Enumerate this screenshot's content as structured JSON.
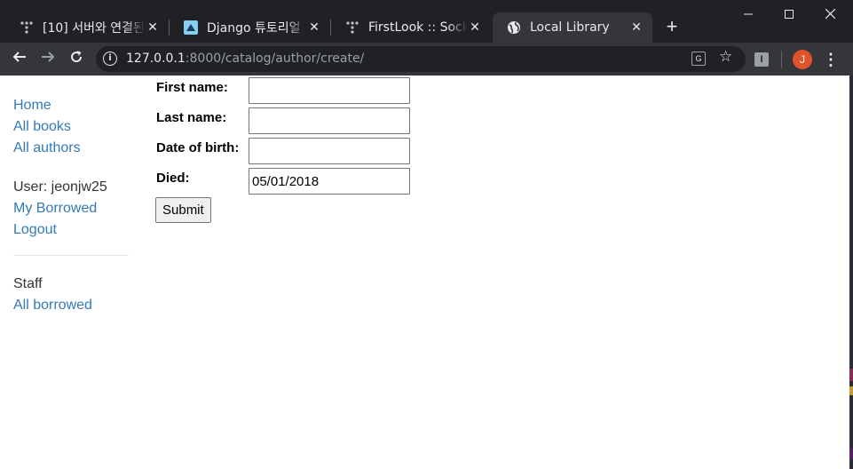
{
  "browser": {
    "tabs": [
      {
        "title": "[10] 서버와 연결된",
        "favicon": "tistory-icon"
      },
      {
        "title": "Django 튜토리얼",
        "favicon": "mdn-icon"
      },
      {
        "title": "FirstLook :: Socket",
        "favicon": "tistory-icon"
      },
      {
        "title": "Local Library",
        "favicon": "globe-icon"
      }
    ],
    "url": {
      "host": "127.0.0.1",
      "rest": ":8000/catalog/author/create/"
    },
    "profile_initial": "J",
    "extension_label": "I"
  },
  "sidebar": {
    "links": [
      "Home",
      "All books",
      "All authors"
    ],
    "user_label": "User: jeonjw25",
    "user_links": [
      "My Borrowed",
      "Logout"
    ],
    "staff_label": "Staff",
    "staff_links": [
      "All borrowed"
    ]
  },
  "form": {
    "fields": [
      {
        "label": "First name:",
        "value": ""
      },
      {
        "label": "Last name:",
        "value": ""
      },
      {
        "label": "Date of birth:",
        "value": ""
      },
      {
        "label": "Died:",
        "value": "05/01/2018"
      }
    ],
    "submit_label": "Submit"
  },
  "colors": {
    "link": "#337ab7",
    "chrome_dark": "#202124",
    "chrome_toolbar": "#35363a",
    "profile": "#e0532a"
  }
}
